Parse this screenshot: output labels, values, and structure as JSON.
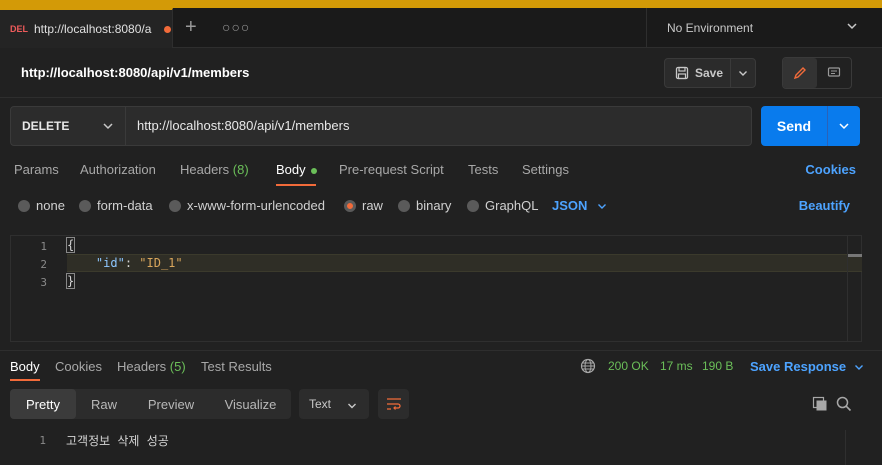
{
  "colors": {
    "accent": "#d39a07",
    "primary": "#097bed",
    "active_tab": "#f26b3a",
    "status_ok": "#6bbf59",
    "link": "#4da3ff",
    "delete_method": "#ef5b5b"
  },
  "tabbar": {
    "tab": {
      "method": "DEL",
      "title": "http://localhost:8080/a",
      "unsaved": true
    },
    "new_tab_icon": "plus-icon",
    "more_icon": "ellipsis-icon"
  },
  "environment": {
    "label": "No Environment"
  },
  "request": {
    "title": "http://localhost:8080/api/v1/members",
    "save_label": "Save",
    "method": "DELETE",
    "url": "http://localhost:8080/api/v1/members",
    "send_label": "Send"
  },
  "request_tabs": {
    "params": "Params",
    "authorization": "Authorization",
    "headers": "Headers",
    "headers_count": "(8)",
    "body": "Body",
    "prerequest": "Pre-request Script",
    "tests": "Tests",
    "settings": "Settings",
    "cookies": "Cookies"
  },
  "body_options": {
    "none": "none",
    "form_data": "form-data",
    "urlencoded": "x-www-form-urlencoded",
    "raw": "raw",
    "binary": "binary",
    "graphql": "GraphQL",
    "format": "JSON",
    "beautify": "Beautify",
    "selected": "raw"
  },
  "editor": {
    "line_numbers": [
      "1",
      "2",
      "3"
    ],
    "open_brace": "{",
    "key": "\"id\"",
    "colon": ": ",
    "value": "\"ID_1\"",
    "close_brace": "}"
  },
  "response": {
    "tabs": {
      "body": "Body",
      "cookies": "Cookies",
      "headers": "Headers",
      "headers_count": "(5)",
      "test_results": "Test Results"
    },
    "status": "200 OK",
    "time": "17 ms",
    "size": "190 B",
    "save_response": "Save Response",
    "views": {
      "pretty": "Pretty",
      "raw": "Raw",
      "preview": "Preview",
      "visualize": "Visualize"
    },
    "format": "Text",
    "line_number": "1",
    "text": "고객정보 삭제 성공"
  }
}
